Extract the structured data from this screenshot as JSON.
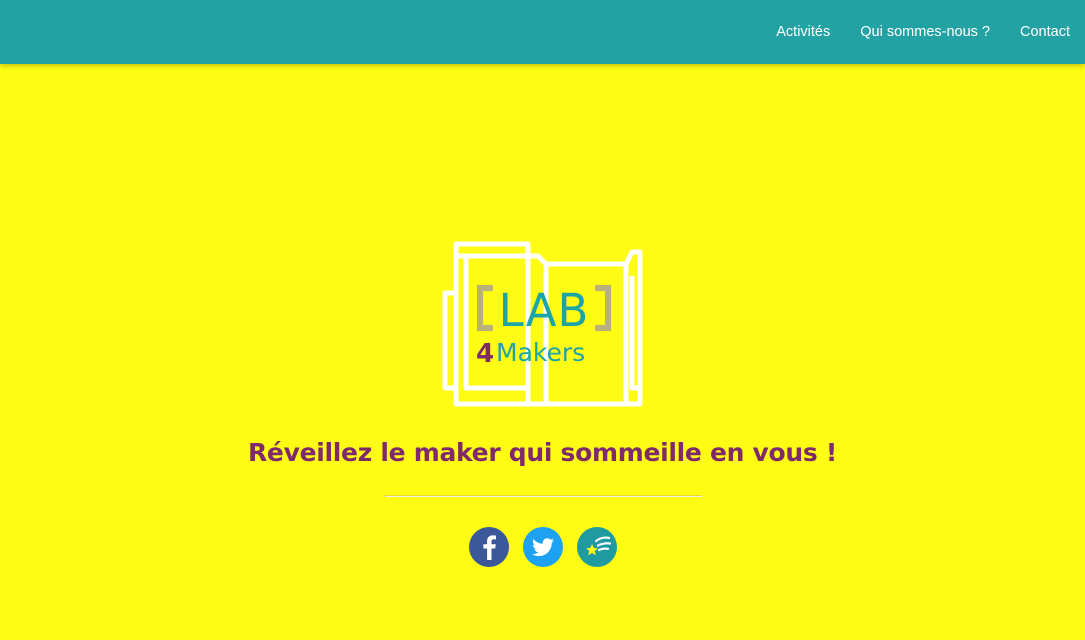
{
  "nav": {
    "items": [
      {
        "label": "Activités"
      },
      {
        "label": "Qui sommes-nous ?"
      },
      {
        "label": "Contact"
      }
    ]
  },
  "hero": {
    "logo": {
      "line1": "LAB",
      "digit": "4",
      "word": "Makers"
    },
    "tagline": "Réveillez le maker qui sommeille en vous !"
  },
  "social": [
    {
      "icon": "facebook-icon",
      "color": "#3B5998"
    },
    {
      "icon": "twitter-icon",
      "color": "#1DA1F2"
    },
    {
      "icon": "shooting-star-icon",
      "color": "#1E9AA0"
    }
  ],
  "colors": {
    "background": "#FEFC14",
    "navbar": "#22A2A2",
    "tagline": "#7F2A6A",
    "logo_lab": "#1BA5A8",
    "logo_brackets": "#B8B07A",
    "logo_four": "#7F2A6A",
    "logo_makers": "#1BA5A8"
  }
}
